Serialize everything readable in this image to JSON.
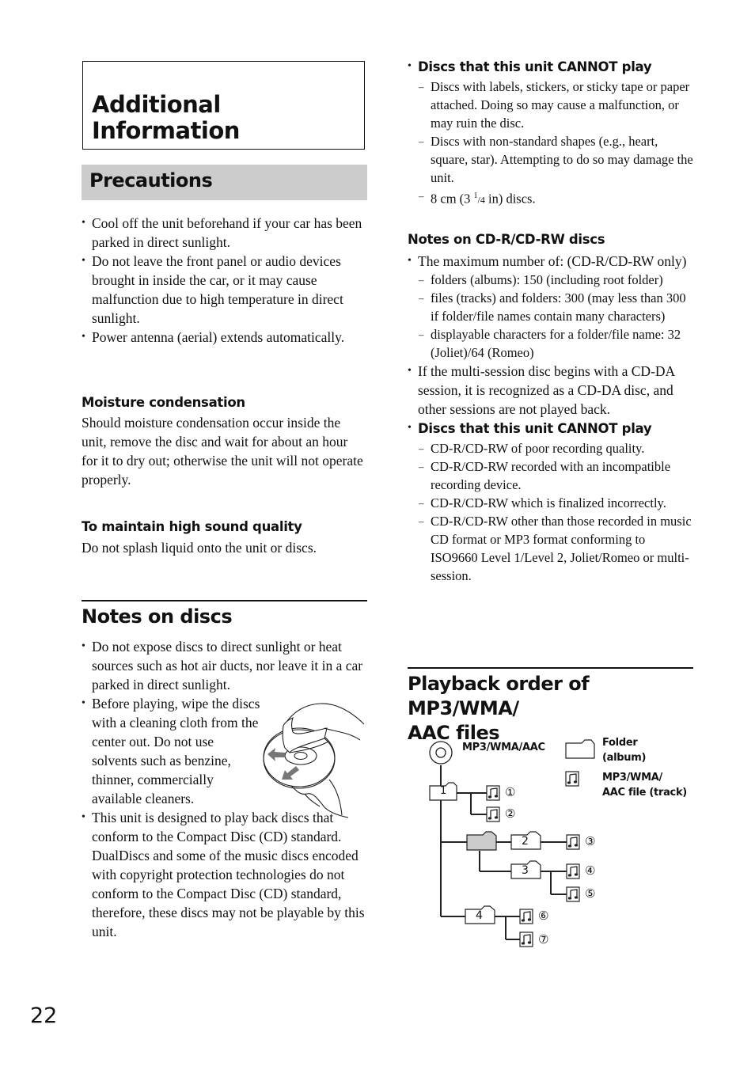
{
  "page_number": "22",
  "chapter": {
    "title_line1": "Additional",
    "title_line2": "Information"
  },
  "precautions": {
    "title": "Precautions",
    "bullets": [
      "Cool off the unit beforehand if your car has been parked in direct sunlight.",
      "Do not leave the front panel or audio devices brought in inside the car, or it may cause malfunction due to high temperature in direct sunlight.",
      "Power antenna (aerial) extends automatically."
    ],
    "moisture": {
      "heading": "Moisture condensation",
      "text": "Should moisture condensation occur inside the unit, remove the disc and wait for about an hour for it to dry out; otherwise the unit will not operate properly."
    },
    "sound_quality": {
      "heading": "To maintain high sound quality",
      "text": "Do not splash liquid onto the unit or discs."
    }
  },
  "notes_on_discs": {
    "title": "Notes on discs",
    "bullets": [
      "Do not expose discs to direct sunlight or heat sources such as hot air ducts, nor leave it in a car parked in direct sunlight.",
      "Before playing, wipe the discs with a cleaning cloth from the center out. Do not use solvents such as benzine, thinner, commercially available cleaners.",
      "This unit is designed to play back discs that conform to the Compact Disc (CD) standard. DualDiscs and some of the music discs encoded with copyright protection technologies do not conform to the Compact Disc (CD) standard, therefore, these discs may not be playable by this unit."
    ],
    "illustration": "disc-cleaning-illustration",
    "cannot_play": {
      "heading": "Discs that this unit CANNOT play",
      "items": [
        "Discs with labels, stickers, or sticky tape or paper attached. Doing so may cause a malfunction, or may ruin the disc.",
        "Discs with non-standard shapes (e.g., heart, square, star). Attempting to do so may damage the unit."
      ],
      "item3_prefix": "8 cm (3 ",
      "item3_sup": "1",
      "item3_frac": "/4",
      "item3_suffix": " in) discs."
    }
  },
  "cdr_notes": {
    "heading": "Notes on CD-R/CD-RW discs",
    "max_bullet": "The maximum number of: (CD-R/CD-RW only)",
    "max_items": [
      "folders (albums): 150 (including root folder)",
      "files (tracks) and folders: 300 (may less than 300 if folder/file names contain many characters)",
      "displayable characters for a folder/file name: 32 (Joliet)/64 (Romeo)"
    ],
    "multisession_bullet": "If the multi-session disc begins with a CD-DA session, it is recognized as a CD-DA disc, and other sessions are not played back.",
    "cannot_play": {
      "heading": "Discs that this unit CANNOT play",
      "items": [
        "CD-R/CD-RW of poor recording quality.",
        "CD-R/CD-RW recorded with an incompatible recording device.",
        "CD-R/CD-RW which is finalized incorrectly.",
        "CD-R/CD-RW other than those recorded in music CD format or MP3 format conforming to ISO9660 Level 1/Level 2, Joliet/Romeo or multi-session."
      ]
    }
  },
  "playback_order": {
    "title_line1": "Playback order of MP3/WMA/",
    "title_line2": "AAC files",
    "diagram": {
      "disc_label": "MP3/WMA/AAC",
      "legend_folder_line1": "Folder",
      "legend_folder_line2": "(album)",
      "legend_file_line1": "MP3/WMA/",
      "legend_file_line2": "AAC file (track)",
      "folders": [
        "1",
        "2",
        "3",
        "4"
      ],
      "tracks": [
        "①",
        "②",
        "③",
        "④",
        "⑤",
        "⑥",
        "⑦"
      ],
      "empty_folder_color": "#cccccc"
    }
  }
}
